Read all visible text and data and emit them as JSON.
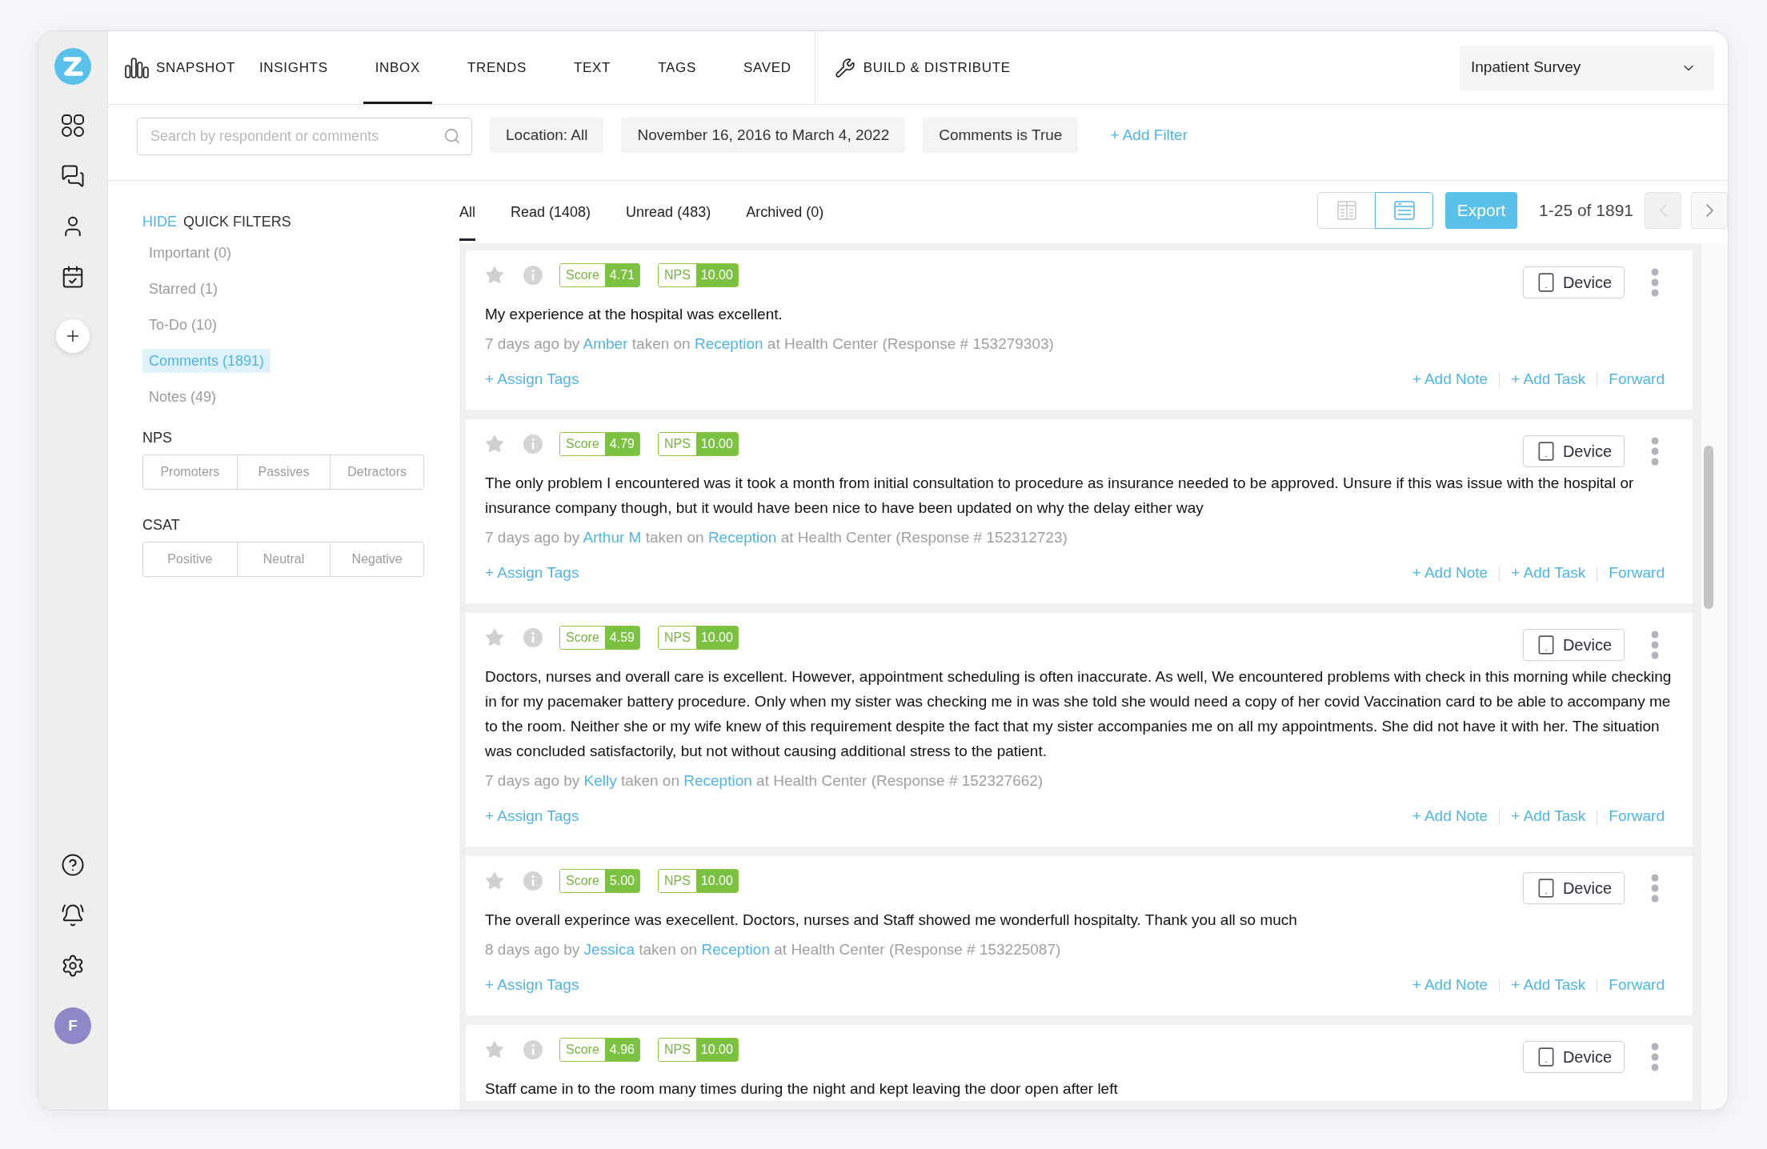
{
  "sidebar": {
    "avatar": {
      "initial": "F"
    }
  },
  "nav": {
    "tabs": [
      {
        "label": "SNAPSHOT",
        "kind": "icon",
        "selected": false
      },
      {
        "label": "INSIGHTS",
        "kind": "plain",
        "selected": false
      },
      {
        "label": "INBOX",
        "kind": "plain",
        "selected": true
      },
      {
        "label": "TRENDS",
        "kind": "plain",
        "selected": false
      },
      {
        "label": "TEXT",
        "kind": "plain",
        "selected": false
      },
      {
        "label": "TAGS",
        "kind": "plain",
        "selected": false
      },
      {
        "label": "SAVED",
        "kind": "plain",
        "selected": false
      }
    ],
    "build_link": {
      "label": "BUILD & DISTRIBUTE"
    },
    "survey_select": {
      "value": "Inpatient Survey"
    }
  },
  "filter_bar": {
    "search": {
      "placeholder": "Search by respondent or comments"
    },
    "chips": [
      {
        "label": "Location: All"
      },
      {
        "label": "November 16, 2016 to March 4, 2022"
      },
      {
        "label": "Comments is True"
      }
    ],
    "add_filter": "+ Add Filter"
  },
  "quick_filters": {
    "hide": "HIDE",
    "title": "QUICK FILTERS",
    "items": [
      {
        "label": "Important (0)",
        "selected": false
      },
      {
        "label": "Starred (1)",
        "selected": false
      },
      {
        "label": "To-Do (10)",
        "selected": false
      },
      {
        "label": "Comments (1891)",
        "selected": true
      },
      {
        "label": "Notes (49)",
        "selected": false
      }
    ],
    "groups": [
      {
        "title": "NPS",
        "options": [
          {
            "label": "Promoters",
            "selected": false
          },
          {
            "label": "Passives",
            "selected": false
          },
          {
            "label": "Detractors",
            "selected": false
          }
        ]
      },
      {
        "title": "CSAT",
        "options": [
          {
            "label": "Positive",
            "selected": false
          },
          {
            "label": "Neutral",
            "selected": false
          },
          {
            "label": "Negative",
            "selected": false
          }
        ]
      }
    ]
  },
  "inbox": {
    "tabs": [
      {
        "label": "All",
        "selected": true
      },
      {
        "label": "Read (1408)",
        "selected": false
      },
      {
        "label": "Unread (483)",
        "selected": false
      },
      {
        "label": "Archived (0)",
        "selected": false
      }
    ],
    "views": [
      {
        "kind": "split",
        "selected": false
      },
      {
        "kind": "list",
        "selected": true
      }
    ],
    "export": "Export",
    "range": "1-25 of 1891",
    "prev": {
      "disabled": true
    },
    "next": {
      "disabled": false
    }
  },
  "responses": [
    {
      "starred": false,
      "score": {
        "label": "Score",
        "value": "4.71"
      },
      "nps": {
        "label": "NPS",
        "value": "10.00"
      },
      "device": "Device",
      "comment": "My experience at the hospital was excellent.",
      "meta": {
        "prefix": "7 days ago by",
        "respondent": "Amber",
        "middle": "taken on",
        "channel": "Reception",
        "suffix": "at Health Center (Response # 153279303)"
      },
      "actions": {
        "assign_tags": "+ Assign Tags",
        "add_note": "+ Add Note",
        "add_task": "+ Add Task",
        "forward": "Forward"
      }
    },
    {
      "starred": false,
      "score": {
        "label": "Score",
        "value": "4.79"
      },
      "nps": {
        "label": "NPS",
        "value": "10.00"
      },
      "device": "Device",
      "comment": "The only problem I encountered was it took a month from initial consultation to procedure as insurance needed to be approved. Unsure if this was issue with the hospital or insurance company though, but it would have been nice to have been updated on why the delay either way",
      "meta": {
        "prefix": "7 days ago by",
        "respondent": "Arthur M",
        "middle": "taken on",
        "channel": "Reception",
        "suffix": "at Health Center (Response # 152312723)"
      },
      "actions": {
        "assign_tags": "+ Assign Tags",
        "add_note": "+ Add Note",
        "add_task": "+ Add Task",
        "forward": "Forward"
      }
    },
    {
      "starred": false,
      "score": {
        "label": "Score",
        "value": "4.59"
      },
      "nps": {
        "label": "NPS",
        "value": "10.00"
      },
      "device": "Device",
      "comment": "Doctors, nurses and overall care is excellent. However, appointment scheduling is often inaccurate. As well, We encountered problems with check in this morning while checking in for my pacemaker battery procedure. Only when my sister was checking me in was she told she would need a copy of her covid Vaccination card to be able to accompany me to the room. Neither she or my wife knew of this requirement despite the fact that my sister accompanies me on all my appointments. She did not have it with her. The situation was concluded satisfactorily, but not without causing additional stress to the patient.",
      "meta": {
        "prefix": "7 days ago by",
        "respondent": "Kelly",
        "middle": "taken on",
        "channel": "Reception",
        "suffix": "at Health Center (Response # 152327662)"
      },
      "actions": {
        "assign_tags": "+ Assign Tags",
        "add_note": "+ Add Note",
        "add_task": "+ Add Task",
        "forward": "Forward"
      }
    },
    {
      "starred": false,
      "score": {
        "label": "Score",
        "value": "5.00"
      },
      "nps": {
        "label": "NPS",
        "value": "10.00"
      },
      "device": "Device",
      "comment": "The overall experince was execellent. Doctors, nurses and Staff showed me wonderfull hospitalty. Thank you all so much",
      "meta": {
        "prefix": "8 days ago by",
        "respondent": "Jessica",
        "middle": "taken on",
        "channel": "Reception",
        "suffix": "at Health Center (Response # 153225087)"
      },
      "actions": {
        "assign_tags": "+ Assign Tags",
        "add_note": "+ Add Note",
        "add_task": "+ Add Task",
        "forward": "Forward"
      }
    },
    {
      "starred": false,
      "score": {
        "label": "Score",
        "value": "4.96"
      },
      "nps": {
        "label": "NPS",
        "value": "10.00"
      },
      "device": "Device",
      "comment": "Staff came in to the room many times during the night and kept leaving the door open after left"
    }
  ]
}
